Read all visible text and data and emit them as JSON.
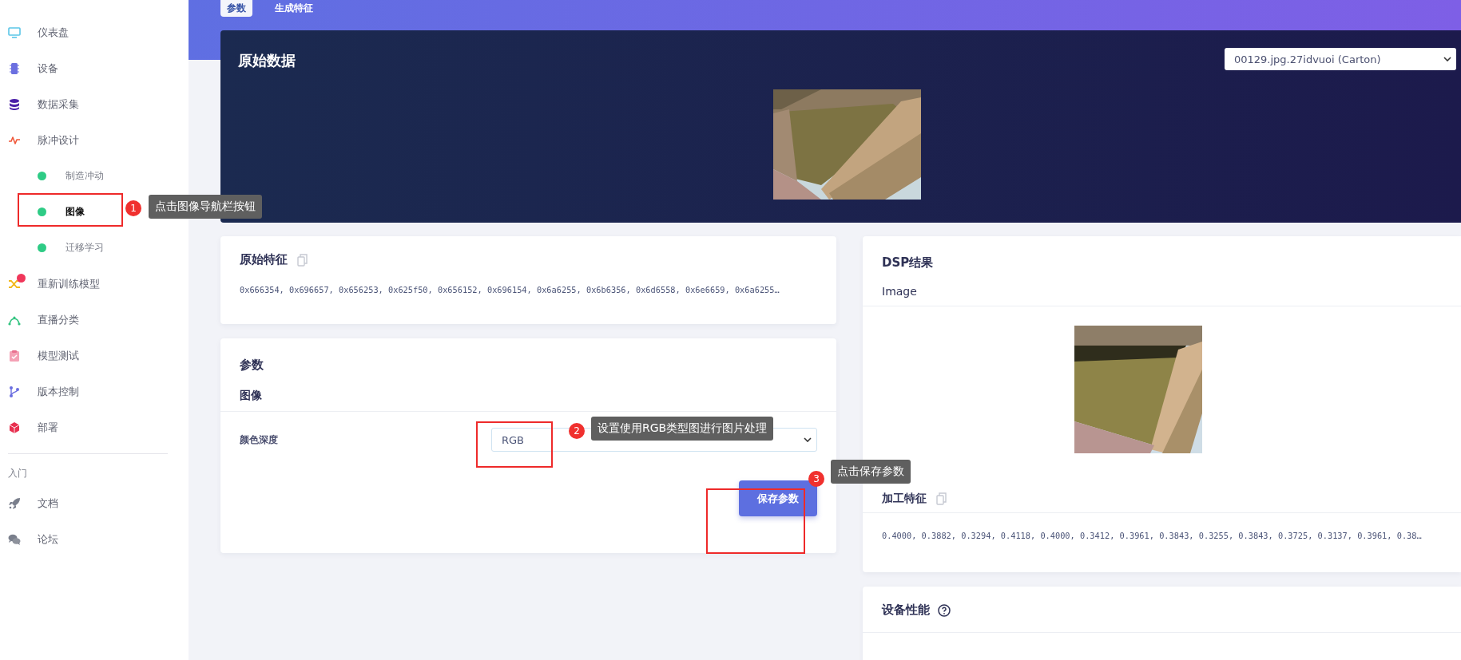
{
  "header_tabs": [
    {
      "label": "参数",
      "selected": true
    },
    {
      "label": "生成特征",
      "selected": false
    }
  ],
  "sidebar": {
    "items": [
      {
        "label": "仪表盘",
        "alert": false
      },
      {
        "label": "设备",
        "alert": false
      },
      {
        "label": "数据采集",
        "alert": false
      },
      {
        "label": "脉冲设计",
        "alert": false,
        "children": [
          {
            "label": "制造冲动",
            "selected": false
          },
          {
            "label": "图像",
            "selected": true
          },
          {
            "label": "迁移学习",
            "selected": false
          }
        ]
      },
      {
        "label": "重新训练模型",
        "alert": true
      },
      {
        "label": "直播分类",
        "alert": false
      },
      {
        "label": "模型测试",
        "alert": false
      },
      {
        "label": "版本控制",
        "alert": false
      },
      {
        "label": "部署",
        "alert": false
      }
    ],
    "section_title": "入门",
    "links": [
      {
        "label": "文档"
      },
      {
        "label": "论坛"
      }
    ]
  },
  "raw_data": {
    "title": "原始数据",
    "sample_select": "00129.jpg.27idvuoi (Carton)"
  },
  "raw_features": {
    "title": "原始特征",
    "values": "0x666354, 0x696657, 0x656253, 0x625f50, 0x656152, 0x696154, 0x6a6255, 0x6b6356, 0x6d6558, 0x6e6659, 0x6a6255…"
  },
  "parameters": {
    "title": "参数",
    "section": "图像",
    "fields": [
      {
        "label": "颜色深度",
        "value": "RGB"
      }
    ],
    "save_button": "保存参数"
  },
  "dsp_result": {
    "title": "DSP结果",
    "subtitle": "Image",
    "processed_features_title": "加工特征",
    "values": "0.4000, 0.3882, 0.3294, 0.4118, 0.4000, 0.3412, 0.3961, 0.3843, 0.3255, 0.3843, 0.3725, 0.3137, 0.3961, 0.38…"
  },
  "device_performance": {
    "title": "设备性能"
  },
  "annotations": [
    {
      "number": "1",
      "text": "点击图像导航栏按钮"
    },
    {
      "number": "2",
      "text": "设置使用RGB类型图进行图片处理"
    },
    {
      "number": "3",
      "text": "点击保存参数"
    }
  ]
}
